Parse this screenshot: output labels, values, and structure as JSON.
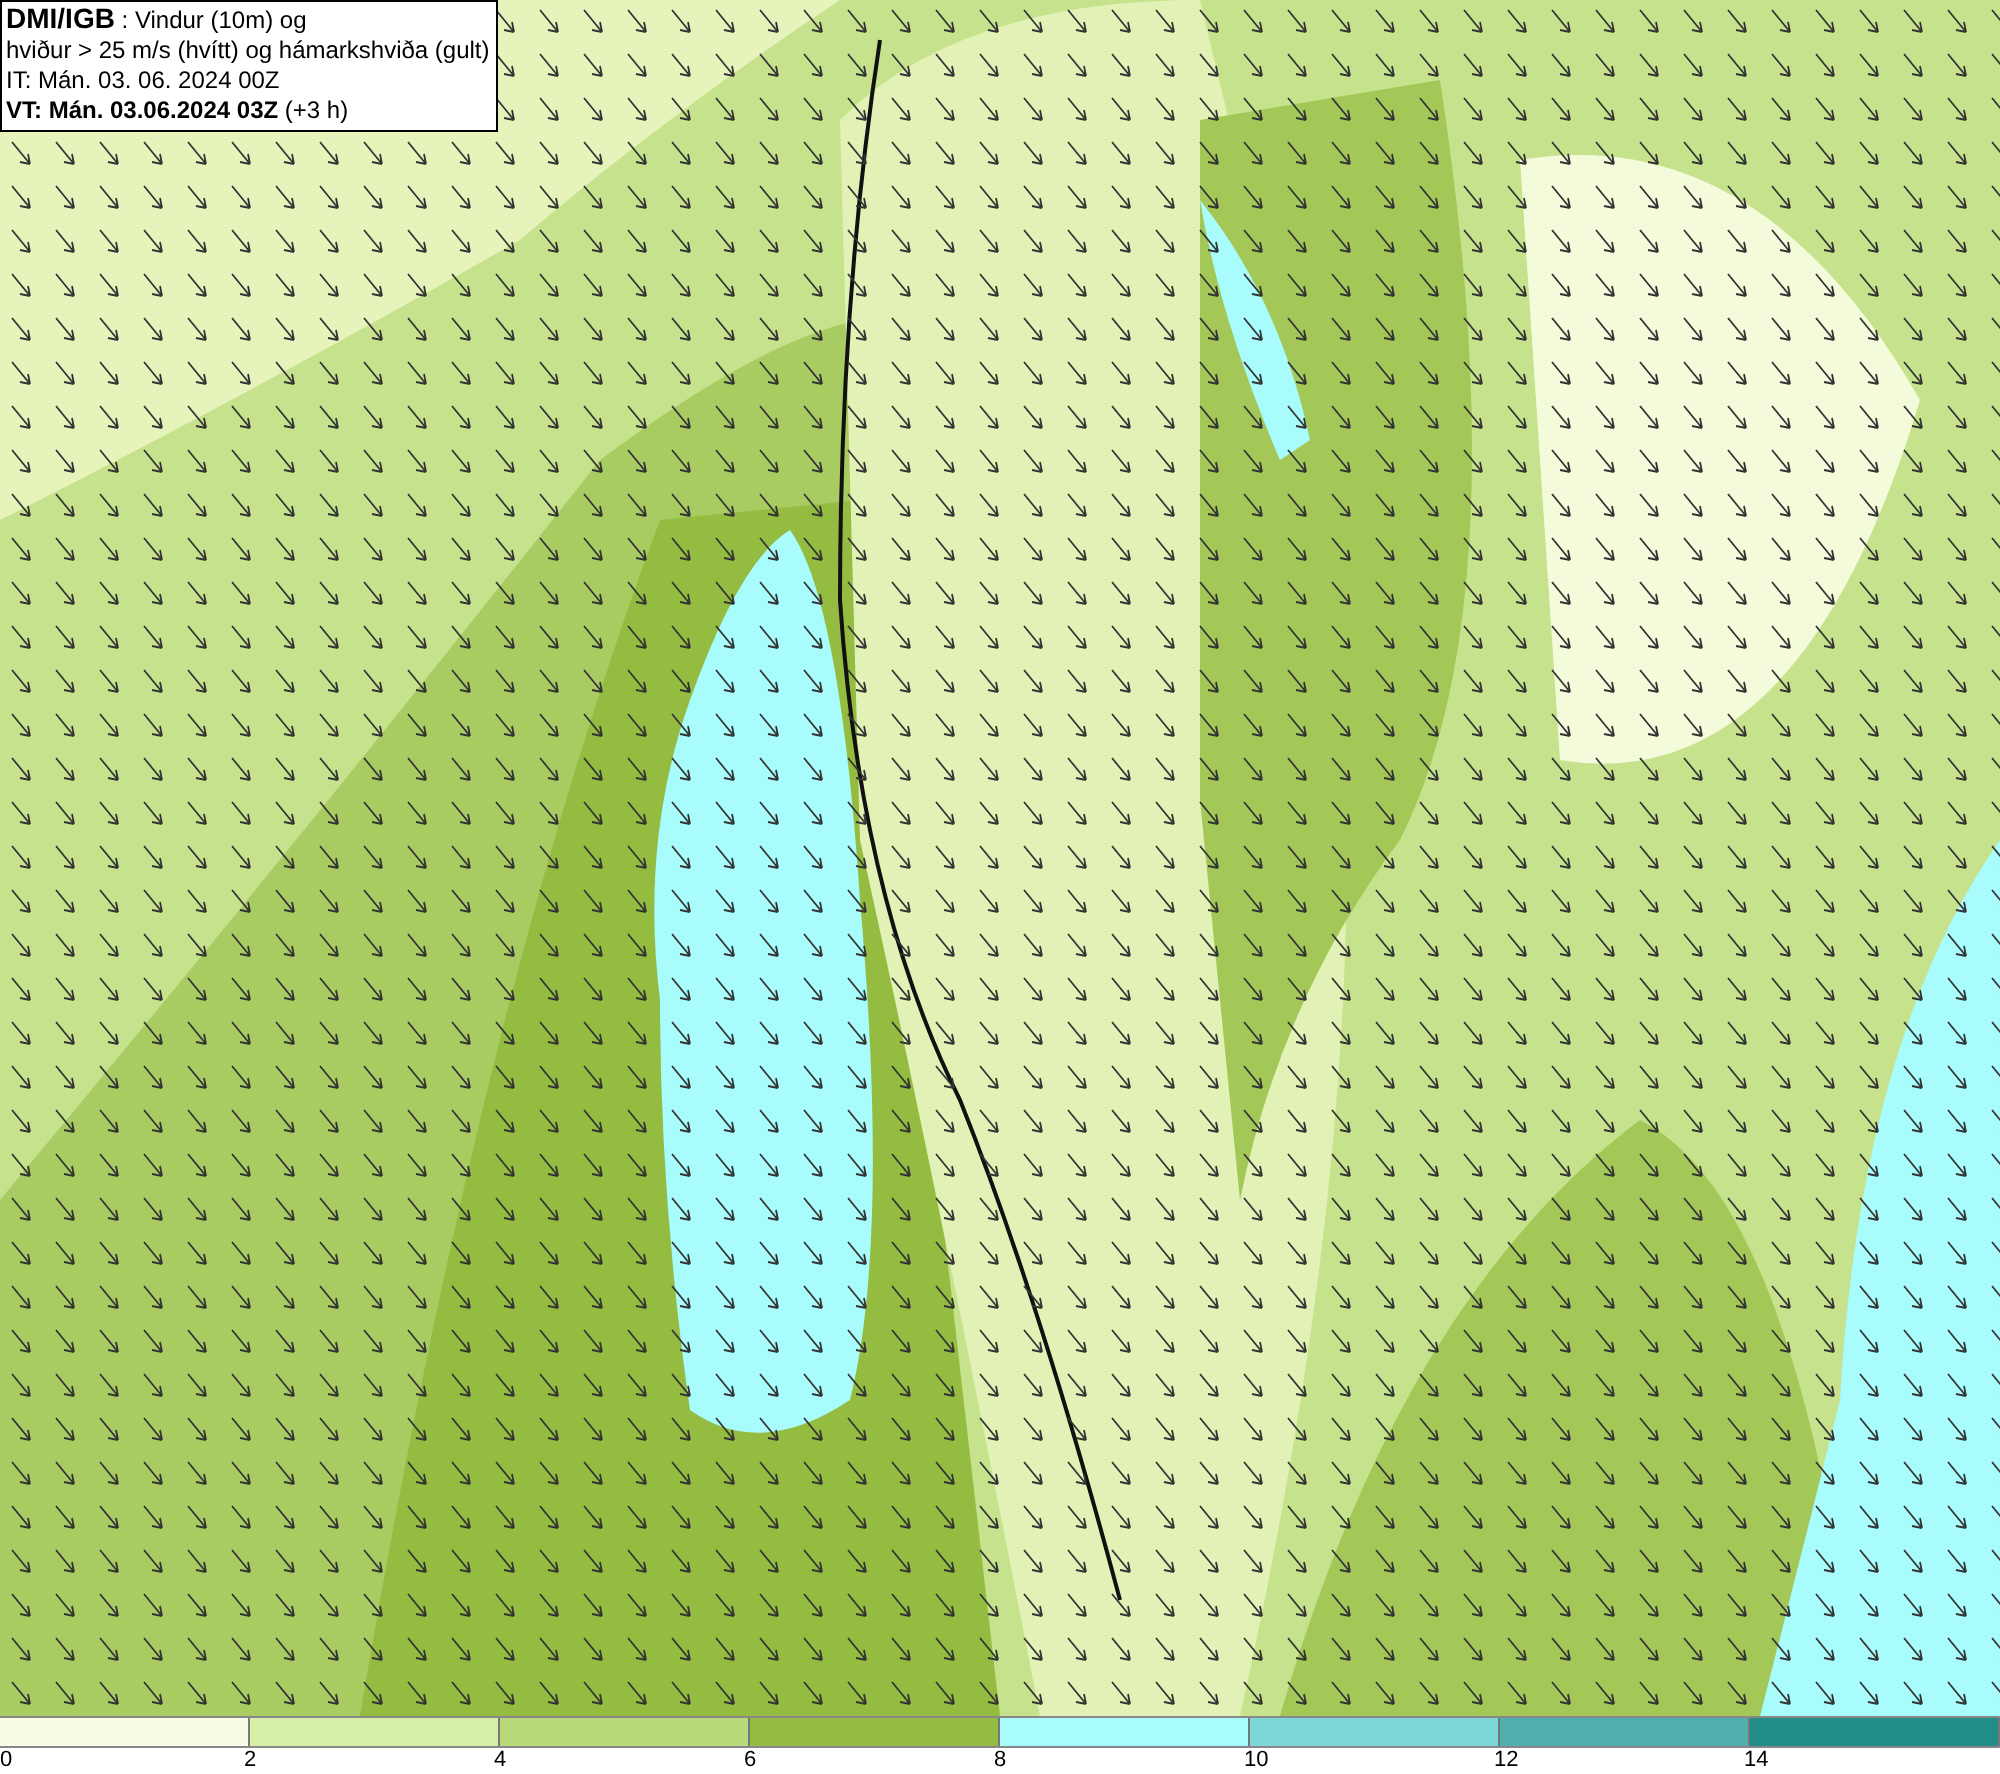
{
  "info_box": {
    "lines": [
      "**DMI/IGB** : Vindur (10m) og",
      "hviður > 25 m/s (hvítt) og hámarkshviða (gult)",
      "IT: Mán. 03. 06. 2024 00Z",
      "**VT: Mán. 03.06.2024 03Z** (+3 h)"
    ]
  },
  "legend": {
    "segments": [
      {
        "label": "0",
        "color": "#f7fde4"
      },
      {
        "label": "2",
        "color": "#d8efa8"
      },
      {
        "label": "4",
        "color": "#b8da78"
      },
      {
        "label": "6",
        "color": "#94bc40"
      },
      {
        "label": "8",
        "color": "#a8fcfc"
      },
      {
        "label": "10",
        "color": "#7cd8d8"
      },
      {
        "label": "12",
        "color": "#50b0b0"
      },
      {
        "label": "14",
        "color": "#228c88"
      }
    ]
  }
}
